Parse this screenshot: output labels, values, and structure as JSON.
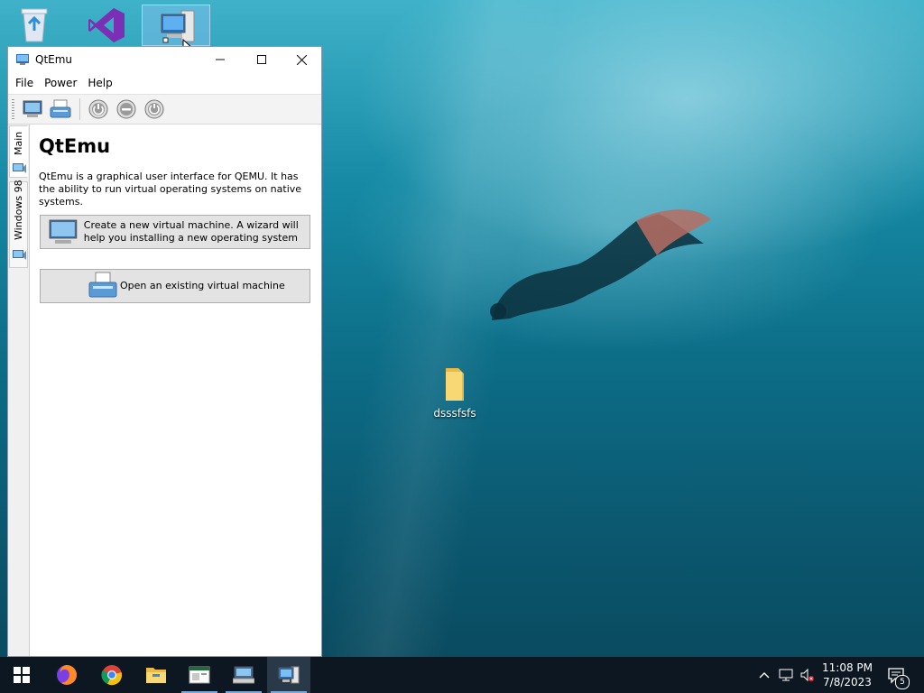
{
  "desktop": {
    "icons": [
      {
        "name": "recycle-bin"
      },
      {
        "name": "visual-studio"
      },
      {
        "name": "qtemu-shortcut"
      },
      {
        "label": "dsssfsfs"
      }
    ]
  },
  "window": {
    "title": "QtEmu",
    "menu": [
      "File",
      "Power",
      "Help"
    ],
    "side_tabs": [
      "Main",
      "Windows 98"
    ],
    "main": {
      "heading": "QtEmu",
      "description": "QtEmu is a graphical user interface for QEMU. It has the ability to run virtual operating systems on native systems.",
      "create_button": "Create a new virtual machine. A wizard will help you installing a new operating system",
      "open_button": "Open an existing virtual machine"
    }
  },
  "taskbar": {
    "apps": [
      "start-icon",
      "firefox-icon",
      "chrome-icon",
      "file-explorer-icon",
      "app-window-icon",
      "network-app-icon",
      "qtemu-taskbar-icon"
    ],
    "clock": {
      "time": "11:08 PM",
      "date": "7/8/2023"
    },
    "notification_count": "5"
  },
  "colors": {
    "taskbar": "#0c1722",
    "accent": "#7aa7d6",
    "button_face": "#e3e3e3"
  }
}
